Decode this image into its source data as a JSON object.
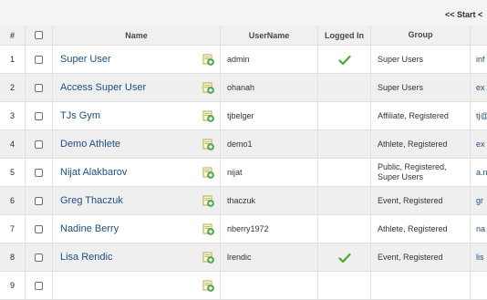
{
  "pager": {
    "text": "<< Start <"
  },
  "columns": {
    "num": "#",
    "name": "Name",
    "username": "UserName",
    "logged_in": "Logged In",
    "group": "Group"
  },
  "rows": [
    {
      "num": "1",
      "name": "Super User",
      "username": "admin",
      "logged_in": true,
      "group": "Super Users",
      "email": "inf"
    },
    {
      "num": "2",
      "name": "Access Super User",
      "username": "ohanah",
      "logged_in": false,
      "group": "Super Users",
      "email": "ex"
    },
    {
      "num": "3",
      "name": "TJs Gym",
      "username": "tjbelger",
      "logged_in": false,
      "group": "Affiliate, Registered",
      "email": "tj@"
    },
    {
      "num": "4",
      "name": "Demo Athlete",
      "username": "demo1",
      "logged_in": false,
      "group": "Athlete, Registered",
      "email": "ex"
    },
    {
      "num": "5",
      "name": "Nijat Alakbarov",
      "username": "nijat",
      "logged_in": false,
      "group": "Public, Registered, Super Users",
      "email": "a.n"
    },
    {
      "num": "6",
      "name": "Greg Thaczuk",
      "username": "thaczuk",
      "logged_in": false,
      "group": "Event, Registered",
      "email": "gr"
    },
    {
      "num": "7",
      "name": "Nadine Berry",
      "username": "nberry1972",
      "logged_in": false,
      "group": "Athlete, Registered",
      "email": "na"
    },
    {
      "num": "8",
      "name": "Lisa Rendic",
      "username": "lrendic",
      "logged_in": true,
      "group": "Event, Registered",
      "email": "lis"
    },
    {
      "num": "9",
      "name": "",
      "username": "",
      "logged_in": false,
      "group": "",
      "email": ""
    }
  ],
  "icons": {
    "edit": "user-edit-icon",
    "logged_in": "checkmark-icon"
  },
  "colors": {
    "link": "#1d4f84",
    "row_alt": "#efefef",
    "check": "#4da82c"
  }
}
